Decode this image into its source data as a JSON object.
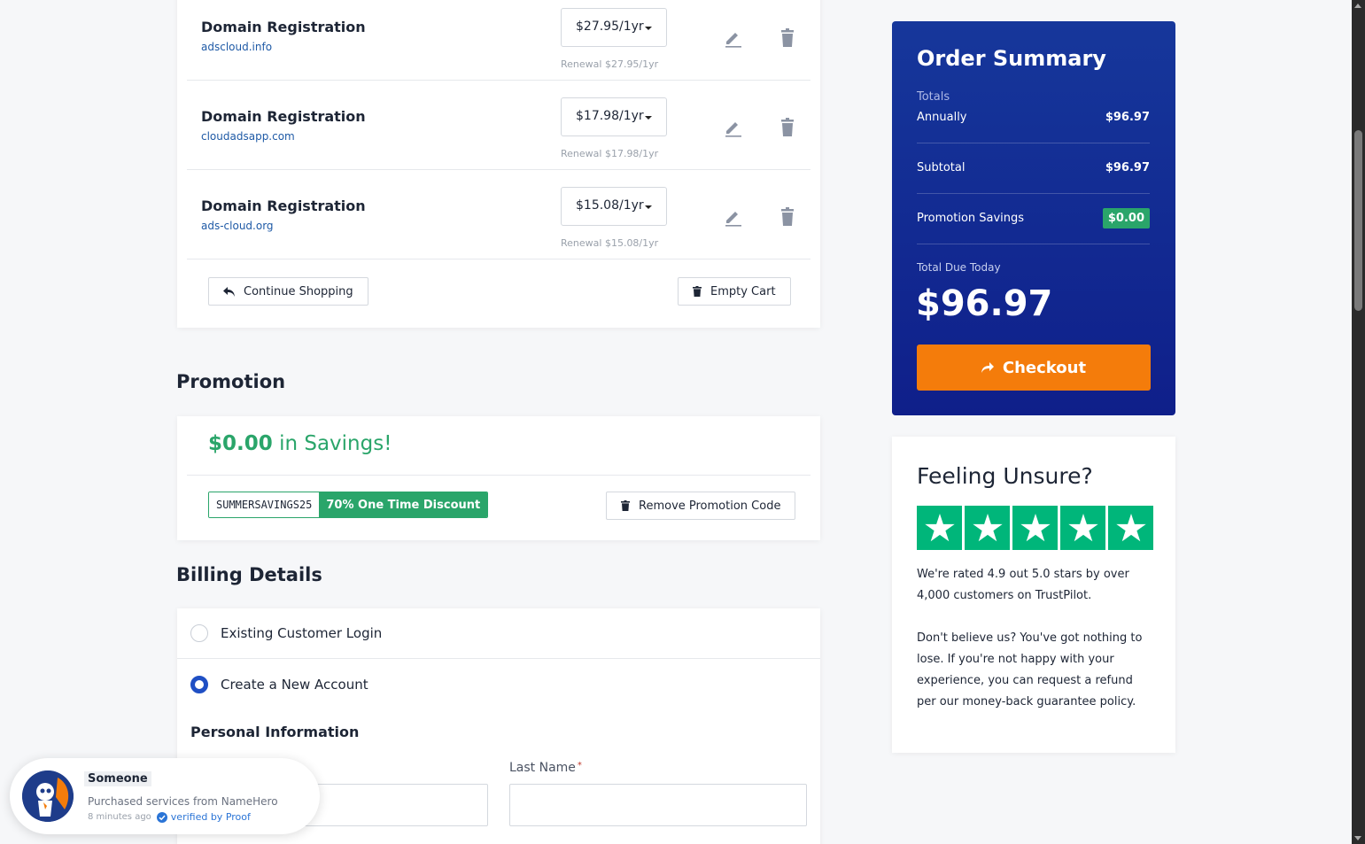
{
  "cart": {
    "items": [
      {
        "title": "Domain Registration",
        "domain": "adscloud.info",
        "price": "$27.95/1yr",
        "renewal": "Renewal $27.95/1yr"
      },
      {
        "title": "Domain Registration",
        "domain": "cloudadsapp.com",
        "price": "$17.98/1yr",
        "renewal": "Renewal $17.98/1yr"
      },
      {
        "title": "Domain Registration",
        "domain": "ads-cloud.org",
        "price": "$15.08/1yr",
        "renewal": "Renewal $15.08/1yr"
      }
    ],
    "continue_label": "Continue Shopping",
    "empty_label": "Empty Cart"
  },
  "promotion": {
    "heading": "Promotion",
    "amount": "$0.00",
    "amount_suffix": "in Savings!",
    "code": "SUMMERSAVINGS25",
    "code_desc": "70% One Time Discount",
    "remove_label": "Remove Promotion Code"
  },
  "billing": {
    "heading": "Billing Details",
    "existing_label": "Existing Customer Login",
    "new_label": "Create a New Account",
    "personal_heading": "Personal Information",
    "last_name_label": "Last Name",
    "required_mark": "*"
  },
  "summary": {
    "title": "Order Summary",
    "totals_label": "Totals",
    "annually_label": "Annually",
    "annually_value": "$96.97",
    "subtotal_label": "Subtotal",
    "subtotal_value": "$96.97",
    "savings_label": "Promotion Savings",
    "savings_value": "$0.00",
    "due_label": "Total Due Today",
    "due_value": "$96.97",
    "checkout_label": "Checkout"
  },
  "unsure": {
    "title": "Feeling Unsure?",
    "rating_text": "We're rated 4.9 out 5.0 stars by over 4,000 customers on TrustPilot.",
    "refund_text": "Don't believe us? You've got nothing to lose. If you're not happy with your experience, you can request a refund per our money-back guarantee policy.",
    "stars": 5
  },
  "proof": {
    "who": "Someone",
    "what": "Purchased services from NameHero",
    "when": "8 minutes ago",
    "verified": "verified by Proof"
  },
  "colors": {
    "accent_blue": "#16379b",
    "savings_green": "#2aa56a",
    "checkout_orange": "#f47c0b",
    "trustpilot_green": "#00b67a"
  }
}
